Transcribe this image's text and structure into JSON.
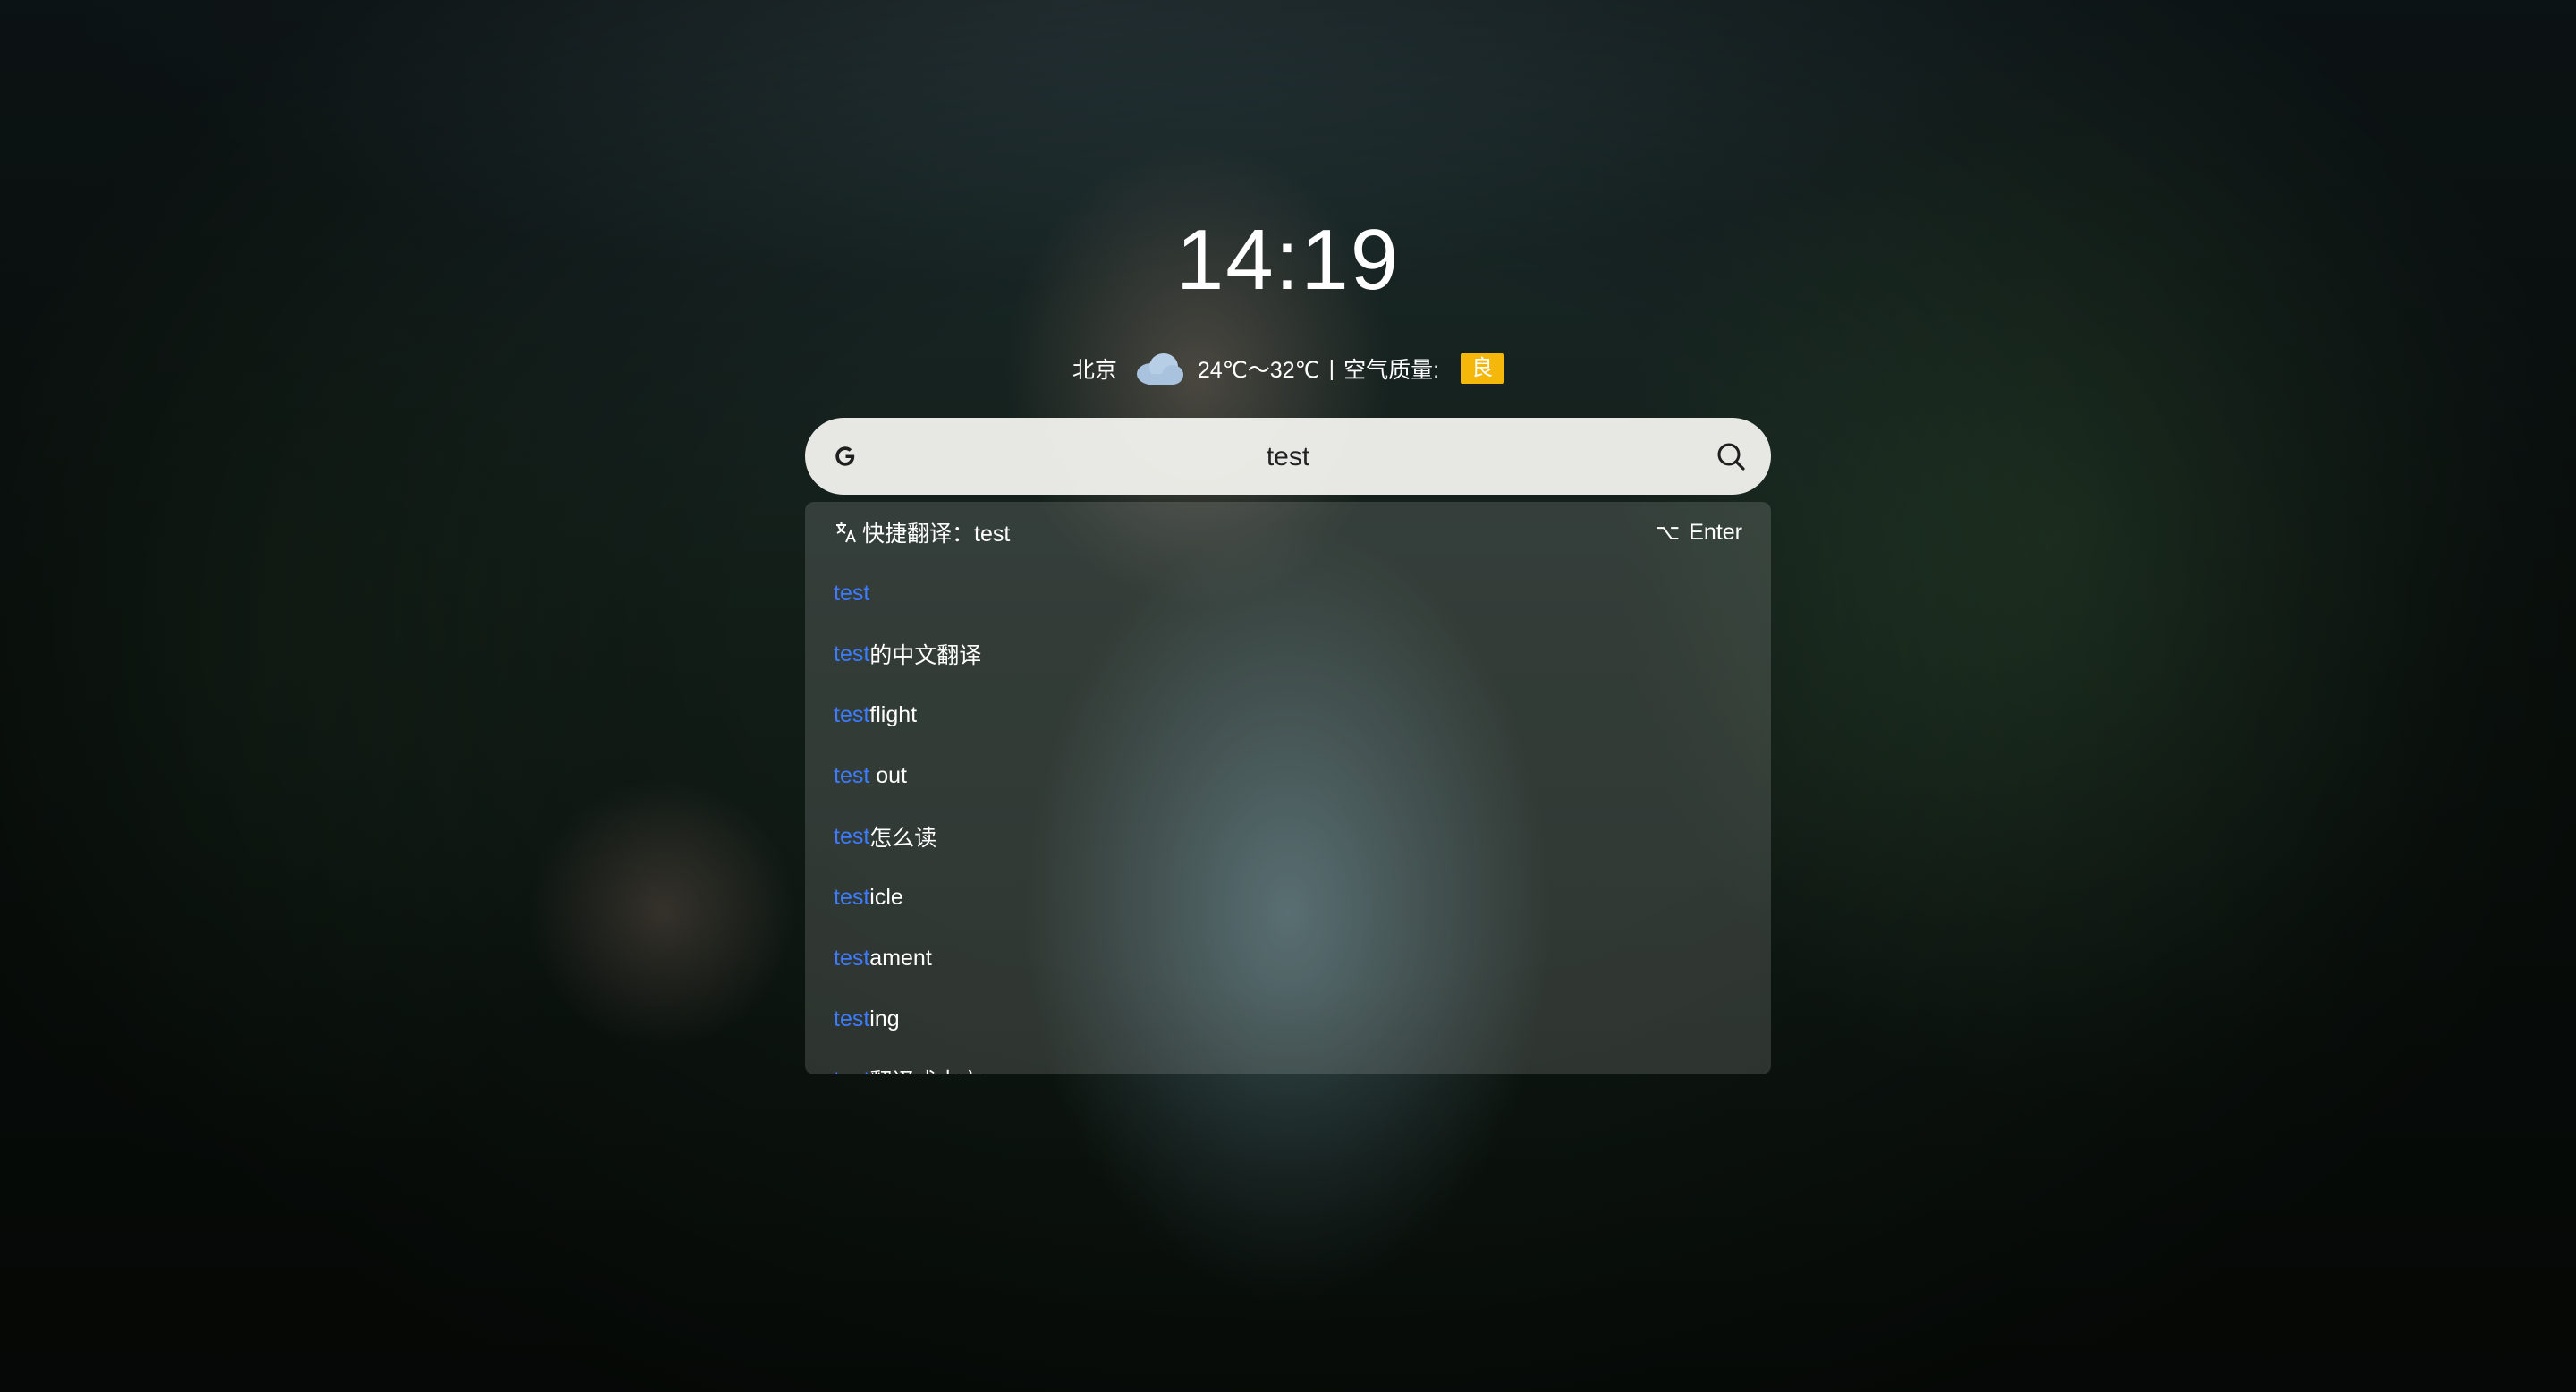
{
  "clock": {
    "time": "14:19"
  },
  "weather": {
    "city": "北京",
    "icon": "cloud-icon",
    "temperature": "24℃～32℃",
    "separator": "|",
    "air_quality_label": "空气质量:",
    "air_quality_value": "良",
    "air_quality_color": "#f5b70a"
  },
  "search": {
    "engine_icon": "G",
    "query": "test",
    "search_button_icon": "search-icon"
  },
  "dropdown": {
    "translate": {
      "icon": "translate-icon",
      "label": "快捷翻译：test",
      "shortcut_symbol": "⌥",
      "shortcut_key": "Enter"
    },
    "suggestions": [
      {
        "match": "test",
        "rest": ""
      },
      {
        "match": "test",
        "rest": "的中文翻译"
      },
      {
        "match": "test",
        "rest": "flight"
      },
      {
        "match": "test",
        "rest": " out"
      },
      {
        "match": "test",
        "rest": "怎么读"
      },
      {
        "match": "test",
        "rest": "icle"
      },
      {
        "match": "test",
        "rest": "ament"
      },
      {
        "match": "test",
        "rest": "ing"
      },
      {
        "match": "test",
        "rest": "翻译成中文"
      }
    ]
  },
  "colors": {
    "highlight": "#3d7bff",
    "search_bar": "#f4f4f0"
  }
}
